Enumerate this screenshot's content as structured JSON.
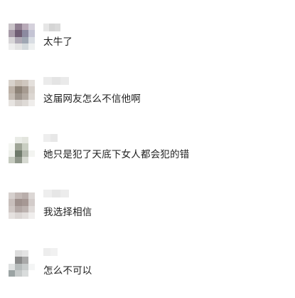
{
  "comments": [
    {
      "text": "太牛了"
    },
    {
      "text": "这届网友怎么不信他啊"
    },
    {
      "text": "她只是犯了天底下女人都会犯的错"
    },
    {
      "text": "我选择相信"
    },
    {
      "text": "怎么不可以"
    }
  ],
  "colors": {
    "background": "#ffffff",
    "text": "#1f1f1f",
    "username_blur": "#e3e3e3",
    "divider": "#f1f1f1"
  }
}
